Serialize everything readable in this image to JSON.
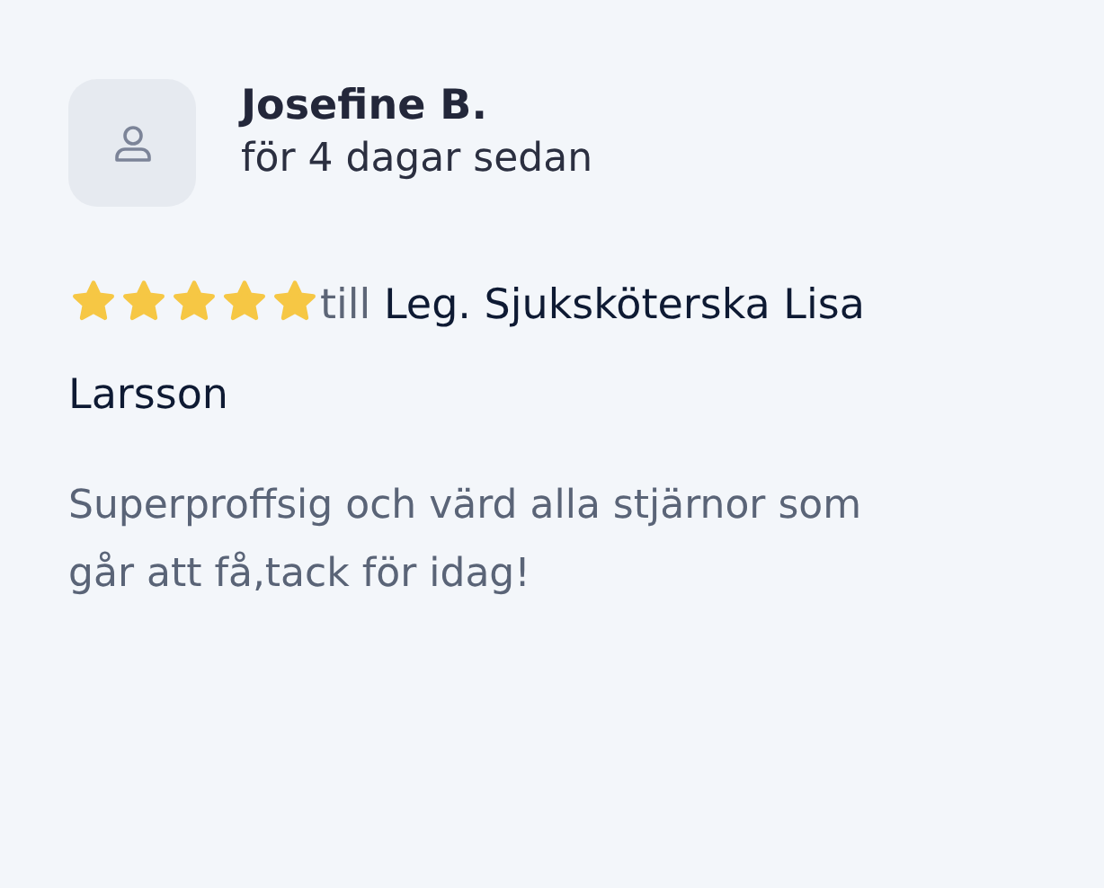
{
  "review": {
    "author": "Josefine B.",
    "time": "för 4 dagar sedan",
    "stars": 5,
    "connector": "till",
    "recipient_lines": [
      "Leg. Sjuksköterska Lisa",
      "Larsson"
    ],
    "text": "Superproffsig och värd alla stjärnor som går att få,tack för idag!"
  }
}
